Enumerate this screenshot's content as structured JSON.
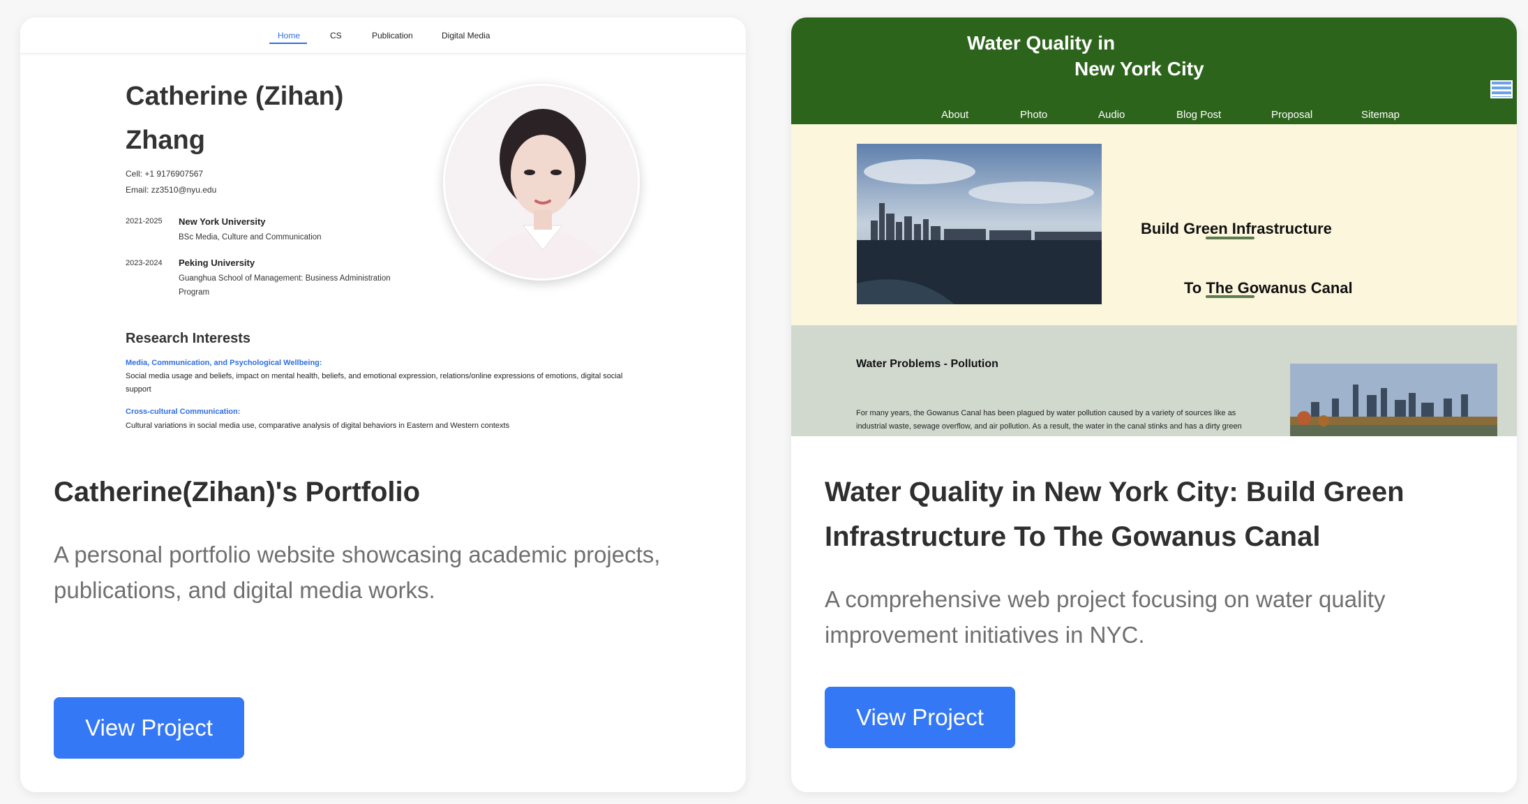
{
  "cards": [
    {
      "title": "Catherine(Zihan)'s Portfolio",
      "description": "A personal portfolio website showcasing academic projects, publications, and digital media works.",
      "button_label": "View Project",
      "preview": {
        "nav": [
          "Home",
          "CS",
          "Publication",
          "Digital Media"
        ],
        "name_line1": "Catherine (Zihan)",
        "name_line2": "Zhang",
        "cell": "Cell: +1 9176907567",
        "email": "Email: zz3510@nyu.edu",
        "education": [
          {
            "years": "2021-2025",
            "school": "New York University",
            "detail": "BSc Media, Culture and Communication",
            "detail2": ""
          },
          {
            "years": "2023-2024",
            "school": "Peking University",
            "detail": "Guanghua School of Management: Business Administration",
            "detail2": "Program"
          }
        ],
        "research_heading": "Research Interests",
        "interests": [
          {
            "label": "Media, Communication, and Psychological Wellbeing:",
            "text1": "Social media usage and beliefs, impact on mental health, beliefs, and emotional expression, relations/online expressions of emotions, digital social",
            "text2": "support"
          },
          {
            "label": "Cross-cultural Communication:",
            "text1": "Cultural variations in social media use, comparative analysis of digital behaviors in Eastern and Western contexts",
            "text2": ""
          }
        ]
      }
    },
    {
      "title_line1": "Water Quality in New York City: Build Green",
      "title_line2": "Infrastructure To The Gowanus Canal",
      "description": "A comprehensive web project focusing on water quality improvement initiatives in NYC.",
      "button_label": "View Project",
      "preview": {
        "title_line1": "Water Quality in",
        "title_line2": "New York City",
        "nav": [
          "About",
          "Photo",
          "Audio",
          "Blog Post",
          "Proposal",
          "Sitemap"
        ],
        "hero_line1": "Build Green Infrastructure",
        "hero_line2": "To The Gowanus Canal",
        "section_heading": "Water Problems - Pollution",
        "para_line1": "For many years, the Gowanus Canal has been plagued by water pollution caused by a variety of sources like as",
        "para_line2": "industrial waste, sewage overflow, and air pollution. As a result, the water in the canal stinks and has a dirty green"
      }
    }
  ],
  "colors": {
    "accent_blue": "#3478f6",
    "water_green": "#2d641c",
    "water_cream": "#fcf6dc",
    "water_grey": "#d1d9cf"
  }
}
